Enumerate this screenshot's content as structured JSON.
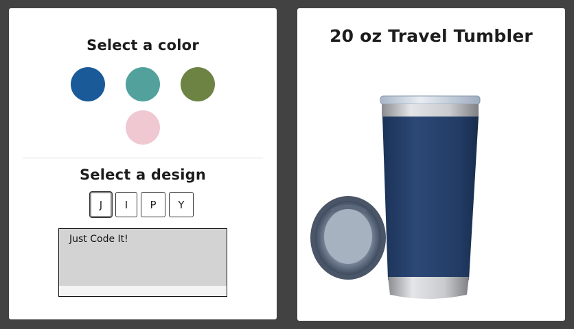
{
  "color_panel": {
    "heading": "Select a color",
    "colors": [
      {
        "name": "blue",
        "hex": "#1b5a99"
      },
      {
        "name": "teal",
        "hex": "#52a19c"
      },
      {
        "name": "olive",
        "hex": "#6c8344"
      },
      {
        "name": "pink",
        "hex": "#efc8d2"
      }
    ]
  },
  "design_panel": {
    "heading": "Select a design",
    "options": [
      "J",
      "I",
      "P",
      "Y"
    ],
    "selected": "J",
    "text_value": "Just Code It!"
  },
  "product": {
    "title": "20 oz Travel Tumbler",
    "image_icon": "tumbler-image",
    "tumbler_color": "#253f68"
  }
}
